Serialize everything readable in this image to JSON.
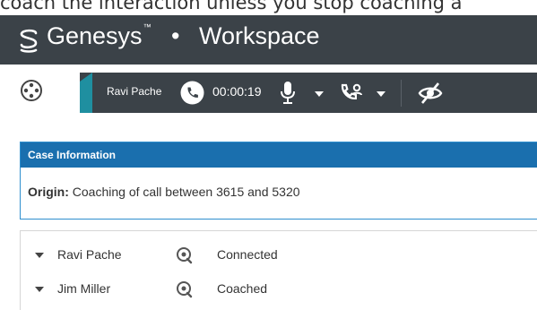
{
  "caption": "coach the interaction unless you stop coaching a",
  "titlebar": {
    "brand": "Genesys",
    "trademark": "™",
    "separator": "•",
    "app": "Workspace",
    "logo_icon": "genesys-logo-icon",
    "background": "#3b4248"
  },
  "toolbar": {
    "main_menu_icon": "vision-menu-icon",
    "call": {
      "party_name": "Ravi Pache",
      "state_icon": "phone-icon",
      "timer": "00:00:19",
      "mic_icon": "microphone-icon",
      "transfer_icon": "call-transfer-icon",
      "hide_icon": "eye-slash-icon",
      "accent_color": "#1f8fa0"
    }
  },
  "case": {
    "header": "Case Information",
    "origin_label": "Origin:",
    "origin_value": "Coaching of call between 3615 and 5320",
    "header_color": "#1a6fae"
  },
  "parties": [
    {
      "name": "Ravi Pache",
      "status": "Connected",
      "icon": "monitoring-icon"
    },
    {
      "name": "Jim Miller",
      "status": "Coached",
      "icon": "monitoring-icon"
    }
  ]
}
